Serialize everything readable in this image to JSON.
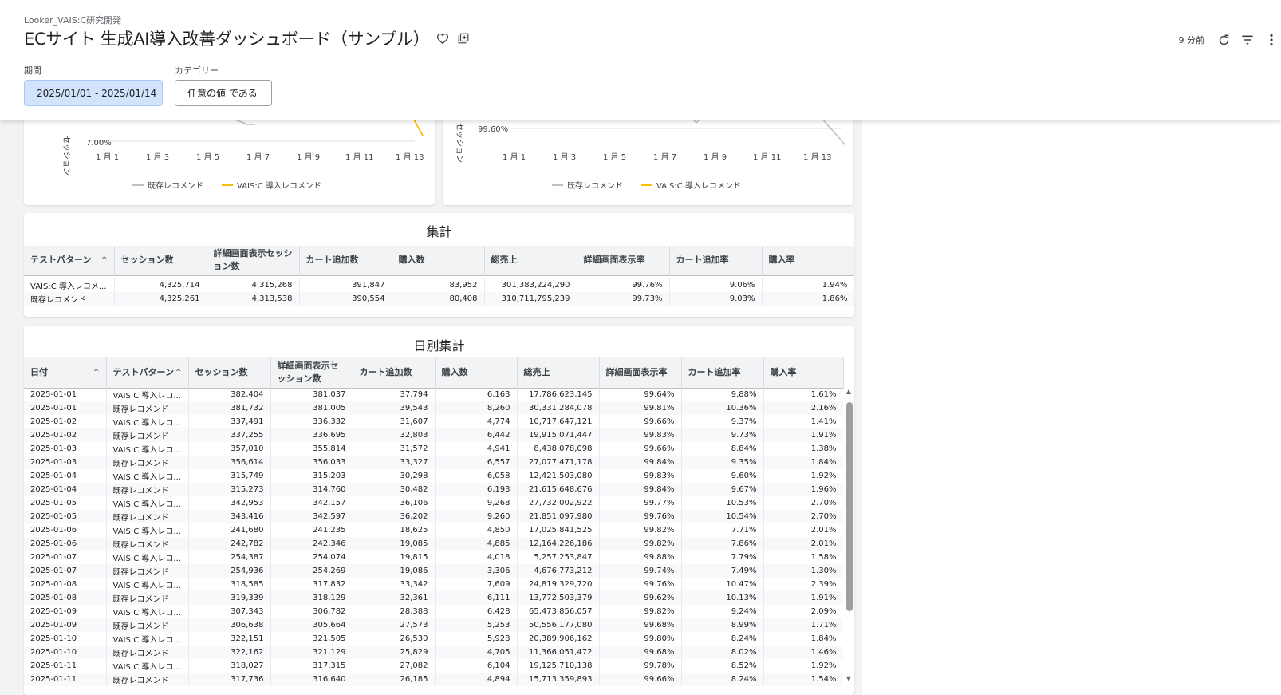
{
  "header": {
    "breadcrumb": "Looker_VAIS:C研究開発",
    "title": "ECサイト 生成AI導入改善ダッシュボード（サンプル）",
    "updated": "9 分前"
  },
  "filters": [
    {
      "label": "期間",
      "value": "2025/01/01 - 2025/01/14"
    },
    {
      "label": "カテゴリー",
      "value": "任意の値 である"
    }
  ],
  "charts": [
    {
      "axis_label": "セッション",
      "ytick": "7.00%",
      "xticks": [
        "1 月 1",
        "1 月 3",
        "1 月 5",
        "1 月 7",
        "1 月 9",
        "1 月 11",
        "1 月 13"
      ],
      "legend": [
        "既存レコメンド",
        "VAIS:C 導入レコメンド"
      ]
    },
    {
      "axis_label": "セッション",
      "ytick": "99.60%",
      "xticks": [
        "1 月 1",
        "1 月 3",
        "1 月 5",
        "1 月 7",
        "1 月 9",
        "1 月 11",
        "1 月 13"
      ],
      "legend": [
        "既存レコメンド",
        "VAIS:C 導入レコメンド"
      ]
    }
  ],
  "colors": {
    "existing": "#bdc1c6",
    "vaisc": "#fbbc04"
  },
  "summary": {
    "title": "集計",
    "columns": [
      "テストパターン",
      "セッション数",
      "詳細画面表示セッション数",
      "カート追加数",
      "購入数",
      "総売上",
      "詳細画面表示率",
      "カート追加率",
      "購入率"
    ],
    "rows": [
      [
        "VAIS:C 導入レコメ...",
        "4,325,714",
        "4,315,268",
        "391,847",
        "83,952",
        "301,383,224,290",
        "99.76%",
        "9.06%",
        "1.94%"
      ],
      [
        "既存レコメンド",
        "4,325,261",
        "4,313,538",
        "390,554",
        "80,408",
        "310,711,795,239",
        "99.73%",
        "9.03%",
        "1.86%"
      ]
    ]
  },
  "daily": {
    "title": "日別集計",
    "columns": [
      "日付",
      "テストパターン",
      "セッション数",
      "詳細画面表示セッション数",
      "カート追加数",
      "購入数",
      "総売上",
      "詳細画面表示率",
      "カート追加率",
      "購入率"
    ],
    "rows": [
      [
        "2025-01-01",
        "VAIS:C 導入レコ...",
        "382,404",
        "381,037",
        "37,794",
        "6,163",
        "17,786,623,145",
        "99.64%",
        "9.88%",
        "1.61%"
      ],
      [
        "2025-01-01",
        "既存レコメンド",
        "381,732",
        "381,005",
        "39,543",
        "8,260",
        "30,331,284,078",
        "99.81%",
        "10.36%",
        "2.16%"
      ],
      [
        "2025-01-02",
        "VAIS:C 導入レコ...",
        "337,491",
        "336,332",
        "31,607",
        "4,774",
        "10,717,647,121",
        "99.66%",
        "9.37%",
        "1.41%"
      ],
      [
        "2025-01-02",
        "既存レコメンド",
        "337,255",
        "336,695",
        "32,803",
        "6,442",
        "19,915,071,447",
        "99.83%",
        "9.73%",
        "1.91%"
      ],
      [
        "2025-01-03",
        "VAIS:C 導入レコ...",
        "357,010",
        "355,814",
        "31,572",
        "4,941",
        "8,438,078,098",
        "99.66%",
        "8.84%",
        "1.38%"
      ],
      [
        "2025-01-03",
        "既存レコメンド",
        "356,614",
        "356,033",
        "33,327",
        "6,557",
        "27,077,471,178",
        "99.84%",
        "9.35%",
        "1.84%"
      ],
      [
        "2025-01-04",
        "VAIS:C 導入レコ...",
        "315,749",
        "315,203",
        "30,298",
        "6,058",
        "12,421,503,080",
        "99.83%",
        "9.60%",
        "1.92%"
      ],
      [
        "2025-01-04",
        "既存レコメンド",
        "315,273",
        "314,760",
        "30,482",
        "6,193",
        "21,615,648,676",
        "99.84%",
        "9.67%",
        "1.96%"
      ],
      [
        "2025-01-05",
        "VAIS:C 導入レコ...",
        "342,953",
        "342,157",
        "36,106",
        "9,268",
        "27,732,002,922",
        "99.77%",
        "10.53%",
        "2.70%"
      ],
      [
        "2025-01-05",
        "既存レコメンド",
        "343,416",
        "342,597",
        "36,202",
        "9,260",
        "21,851,097,980",
        "99.76%",
        "10.54%",
        "2.70%"
      ],
      [
        "2025-01-06",
        "VAIS:C 導入レコ...",
        "241,680",
        "241,235",
        "18,625",
        "4,850",
        "17,025,841,525",
        "99.82%",
        "7.71%",
        "2.01%"
      ],
      [
        "2025-01-06",
        "既存レコメンド",
        "242,782",
        "242,346",
        "19,085",
        "4,885",
        "12,164,226,186",
        "99.82%",
        "7.86%",
        "2.01%"
      ],
      [
        "2025-01-07",
        "VAIS:C 導入レコ...",
        "254,387",
        "254,074",
        "19,815",
        "4,018",
        "5,257,253,847",
        "99.88%",
        "7.79%",
        "1.58%"
      ],
      [
        "2025-01-07",
        "既存レコメンド",
        "254,936",
        "254,269",
        "19,086",
        "3,306",
        "4,676,773,212",
        "99.74%",
        "7.49%",
        "1.30%"
      ],
      [
        "2025-01-08",
        "VAIS:C 導入レコ...",
        "318,585",
        "317,832",
        "33,342",
        "7,609",
        "24,819,329,720",
        "99.76%",
        "10.47%",
        "2.39%"
      ],
      [
        "2025-01-08",
        "既存レコメンド",
        "319,339",
        "318,129",
        "32,361",
        "6,111",
        "13,772,503,379",
        "99.62%",
        "10.13%",
        "1.91%"
      ],
      [
        "2025-01-09",
        "VAIS:C 導入レコ...",
        "307,343",
        "306,782",
        "28,388",
        "6,428",
        "65,473,856,057",
        "99.82%",
        "9.24%",
        "2.09%"
      ],
      [
        "2025-01-09",
        "既存レコメンド",
        "306,638",
        "305,664",
        "27,573",
        "5,253",
        "50,556,177,080",
        "99.68%",
        "8.99%",
        "1.71%"
      ],
      [
        "2025-01-10",
        "VAIS:C 導入レコ...",
        "322,151",
        "321,505",
        "26,530",
        "5,928",
        "20,389,906,162",
        "99.80%",
        "8.24%",
        "1.84%"
      ],
      [
        "2025-01-10",
        "既存レコメンド",
        "322,162",
        "321,129",
        "25,829",
        "4,705",
        "11,366,051,472",
        "99.68%",
        "8.02%",
        "1.46%"
      ],
      [
        "2025-01-11",
        "VAIS:C 導入レコ...",
        "318,027",
        "317,315",
        "27,082",
        "6,104",
        "19,125,710,138",
        "99.78%",
        "8.52%",
        "1.92%"
      ],
      [
        "2025-01-11",
        "既存レコメンド",
        "317,736",
        "316,640",
        "26,185",
        "4,894",
        "15,713,359,893",
        "99.66%",
        "8.24%",
        "1.54%"
      ]
    ]
  }
}
